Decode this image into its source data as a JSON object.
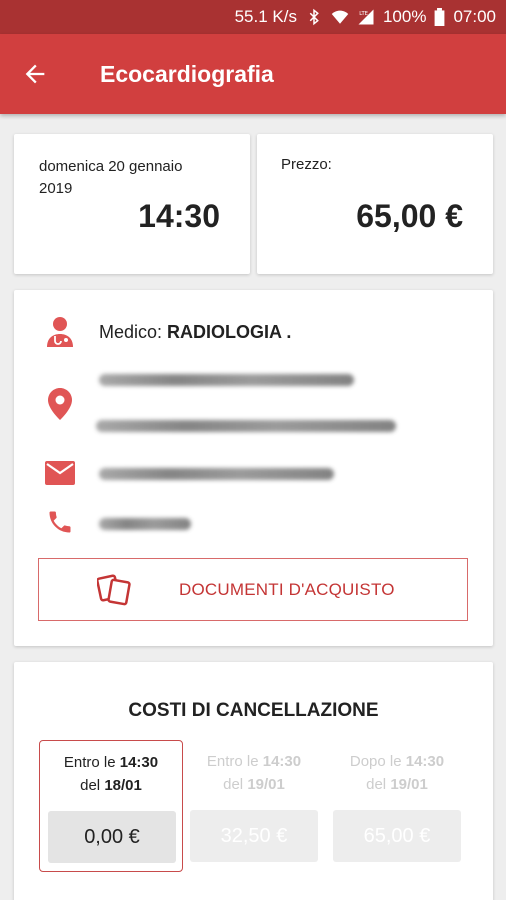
{
  "status_bar": {
    "network_speed": "55.1 K/s",
    "network_type": "LTE",
    "battery": "100%",
    "time": "07:00"
  },
  "app_bar": {
    "title": "Ecocardiografia",
    "back_icon": "arrow-left-icon"
  },
  "appointment": {
    "date_label": "domenica 20 gennaio 2019",
    "time": "14:30",
    "price_label": "Prezzo:",
    "price_value": "65,00 €"
  },
  "details": {
    "doctor_prefix": "Medico:",
    "doctor_name": "RADIOLOGIA .",
    "icons": [
      "doctor-icon",
      "location-pin-icon",
      "mail-icon",
      "phone-icon"
    ],
    "documents_button": "DOCUMENTI D'ACQUISTO",
    "documents_icon": "documents-icon"
  },
  "cancellation": {
    "title": "COSTI DI CANCELLAZIONE",
    "tiers": [
      {
        "prefix": "Entro le",
        "time": "14:30",
        "date_prefix": "del",
        "date": "18/01",
        "amount": "0,00 €",
        "active": true
      },
      {
        "prefix": "Entro le",
        "time": "14:30",
        "date_prefix": "del",
        "date": "19/01",
        "amount": "32,50 €",
        "active": false
      },
      {
        "prefix": "Dopo le",
        "time": "14:30",
        "date_prefix": "del",
        "date": "19/01",
        "amount": "65,00 €",
        "active": false
      }
    ]
  },
  "colors": {
    "primary": "#d13f3f",
    "status_bar": "#a93232",
    "accent_text": "#c43535",
    "background": "#eeeeee"
  }
}
